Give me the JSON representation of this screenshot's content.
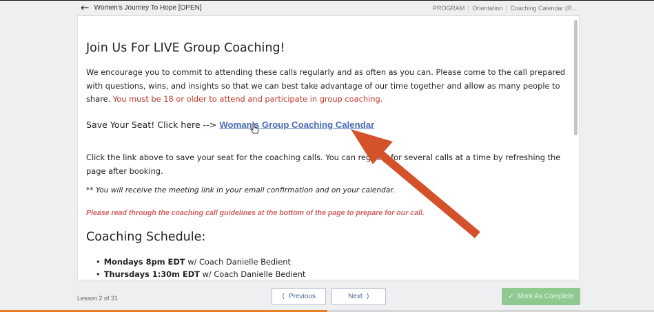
{
  "header": {
    "back_icon": "left-arrow-icon",
    "course_title": "Women's Journey To Hope [OPEN]",
    "breadcrumbs": [
      "PROGRAM",
      "Orientation",
      "Coaching Calendar (R..."
    ]
  },
  "content": {
    "heading": "Join Us For LIVE Group Coaching!",
    "intro": "We encourage you to commit to attending these calls regularly and as often as you can. Please come to the call prepared with questions, wins, and insights so that we can best take advantage of our time together and allow as many people to share.",
    "age_notice": "You must be 18 or older to attend and participate in group coaching.",
    "save_prefix": "Save Your Seat! Click here -->",
    "calendar_link": "Woman's Group Coaching Calendar",
    "booking_info": "Click the link above to save your seat for the coaching calls. You can register for several calls at a time by refreshing the page after booking.",
    "meeting_note": "** You will receive the meeting link in your email confirmation and on your calendar.",
    "guidelines_note": "Please read through the coaching call guidelines at the bottom of the page to prepare for our call.",
    "schedule_heading": "Coaching Schedule:",
    "schedule": [
      {
        "time": "Mondays 8pm EDT",
        "coach": "w/ Coach Danielle Bedient"
      },
      {
        "time": "Thursdays 1:30m EDT",
        "coach": "w/ Coach Danielle Bedient"
      }
    ]
  },
  "footer": {
    "lesson_counter": "Lesson 2 of 31",
    "previous_label": "Previous",
    "next_label": "Next",
    "complete_label": "Mark As Complete",
    "progress_fraction": 0.5
  },
  "colors": {
    "accent_red": "#c0392b",
    "link_blue": "#4a6ab5",
    "arrow_orange": "#d4522a",
    "complete_green": "#8fc98f",
    "progress_orange": "#e67e22"
  }
}
